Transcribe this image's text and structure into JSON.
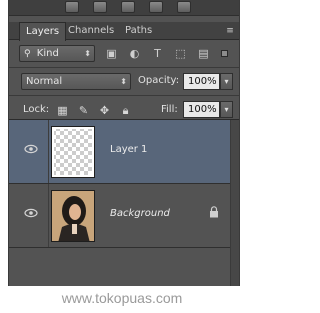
{
  "tabs": [
    {
      "label": "Layers",
      "active": true
    },
    {
      "label": "Channels",
      "active": false
    },
    {
      "label": "Paths",
      "active": false
    }
  ],
  "filter": {
    "kind_label": "Kind",
    "icons": [
      "image-filter-icon",
      "adjustment-filter-icon",
      "type-filter-icon",
      "shape-filter-icon",
      "smart-object-filter-icon"
    ]
  },
  "blend": {
    "mode": "Normal",
    "opacity_label": "Opacity:",
    "opacity_value": "100%"
  },
  "lock": {
    "label": "Lock:",
    "fill_label": "Fill:",
    "fill_value": "100%"
  },
  "layers": [
    {
      "name": "Layer 1",
      "selected": true,
      "visible": true,
      "thumbnail": "transparent"
    },
    {
      "name": "Background",
      "selected": false,
      "visible": true,
      "thumbnail": "photo",
      "locked": true
    }
  ],
  "colors": {
    "panel": "#535353",
    "selected_row": "#58667a",
    "tab_bar": "#424242"
  },
  "watermark": "www.tokopuas.com"
}
